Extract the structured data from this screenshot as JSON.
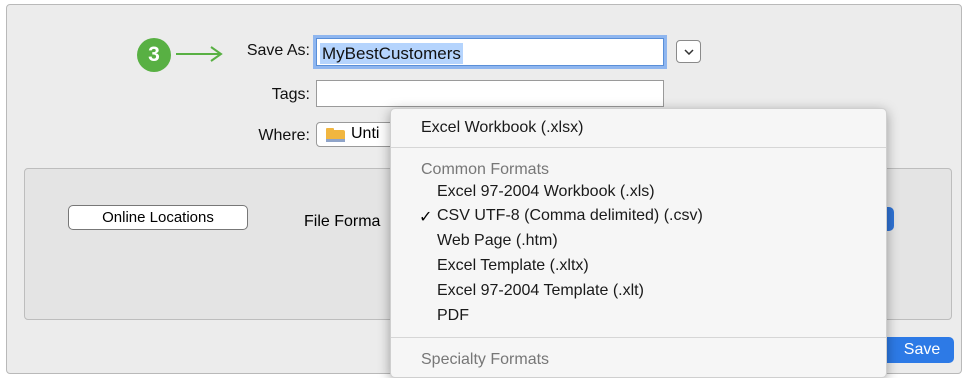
{
  "step": {
    "number": "3"
  },
  "save_as": {
    "label": "Save As:",
    "value": "MyBestCustomers"
  },
  "tags": {
    "label": "Tags:",
    "value": ""
  },
  "where": {
    "label": "Where:",
    "value": "Unti"
  },
  "online_locations": {
    "label": "Online Locations"
  },
  "file_format": {
    "label": "File Forma"
  },
  "save_button": {
    "label": "Save"
  },
  "format_menu": {
    "top_item": "Excel Workbook (.xlsx)",
    "common_header": "Common Formats",
    "common_items": [
      "Excel 97-2004 Workbook (.xls)",
      "CSV UTF-8 (Comma delimited) (.csv)",
      "Web Page (.htm)",
      "Excel Template (.xltx)",
      "Excel 97-2004 Template (.xlt)",
      "PDF"
    ],
    "selected_mark": "✓",
    "specialty_header": "Specialty Formats"
  },
  "colors": {
    "accent": "#2d7ae6",
    "step_badge": "#58b043",
    "selection": "#b5d4fd"
  }
}
